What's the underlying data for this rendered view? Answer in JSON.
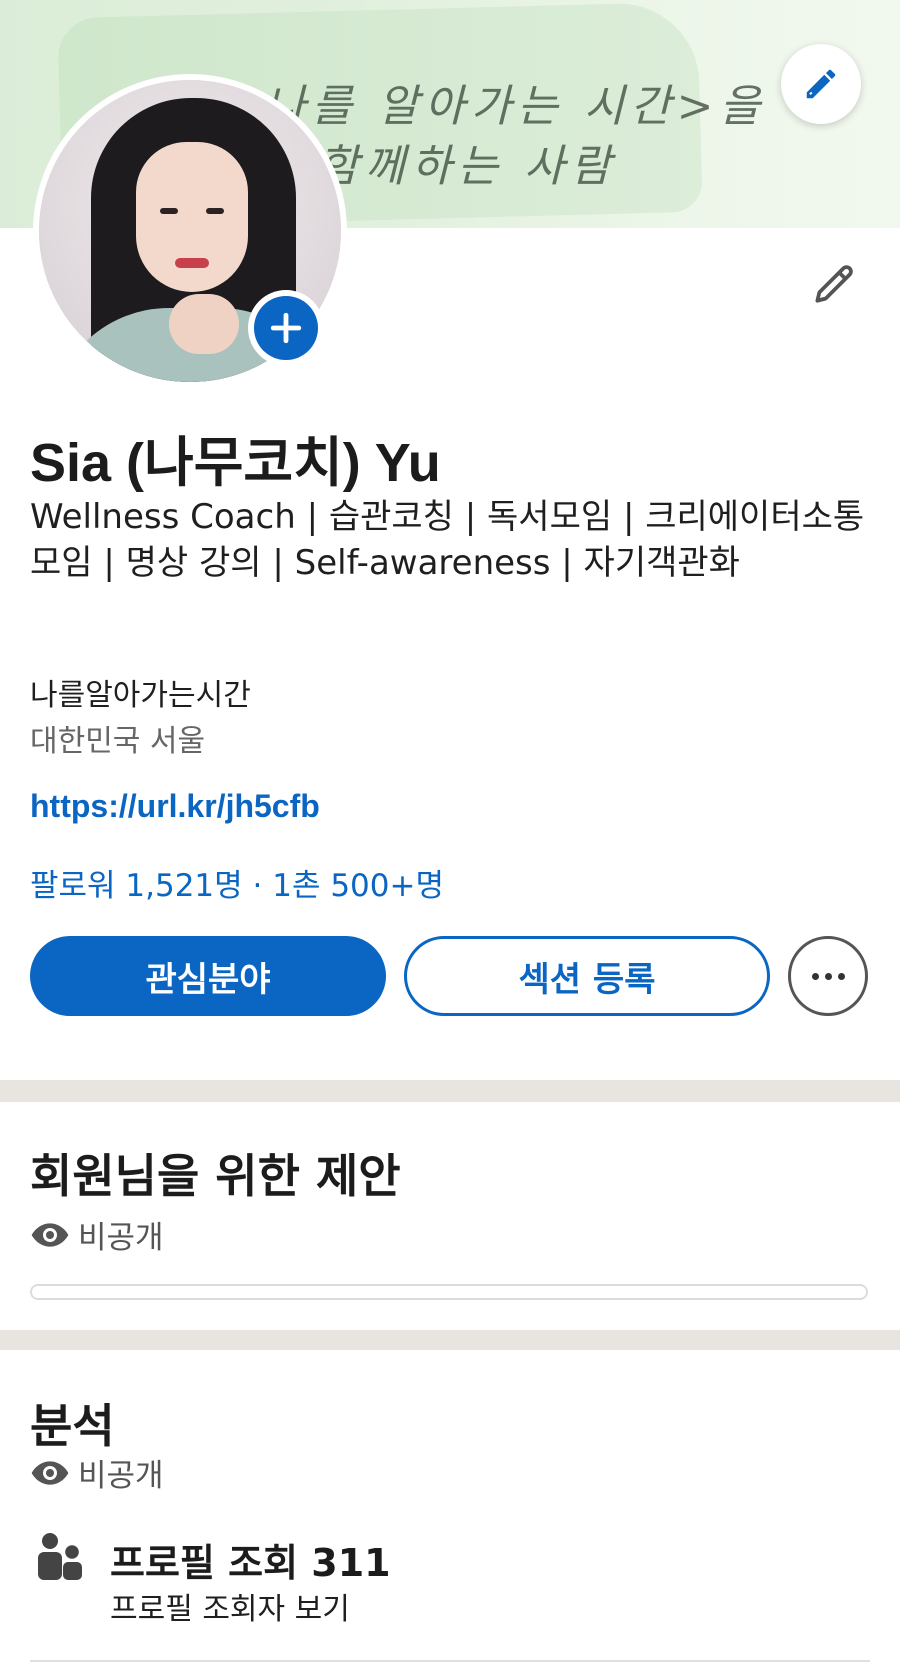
{
  "banner": {
    "line1": "<나를 알아가는 시간>을",
    "line2": "함께하는 사람"
  },
  "profile": {
    "name": "Sia (나무코치) Yu",
    "headline": "Wellness Coach | 습관코칭 | 독서모임 | 크리에이터소통모임 | 명상 강의 | Self-awareness | 자기객관화",
    "organization": "나를알아가는시간",
    "location": "대한민국 서울",
    "link": "https://url.kr/jh5cfb",
    "stats": "팔로워 1,521명 · 1촌 500+명"
  },
  "actions": {
    "primary_label": "관심분야",
    "secondary_label": "섹션 등록",
    "more_icon": "more-horizontal-icon"
  },
  "suggestions": {
    "title": "회원님을 위한 제안",
    "visibility": "비공개",
    "progress": 0
  },
  "analytics": {
    "title": "분석",
    "visibility": "비공개",
    "views_title": "프로필 조회 311",
    "views_sub": "프로필 조회자 보기"
  },
  "colors": {
    "accent": "#0a66c2",
    "banner_bg": "#cfe6cb",
    "divider": "#e8e5e1"
  },
  "icons": [
    "pencil-icon",
    "plus-icon",
    "eye-icon",
    "people-icon",
    "more-horizontal-icon"
  ]
}
